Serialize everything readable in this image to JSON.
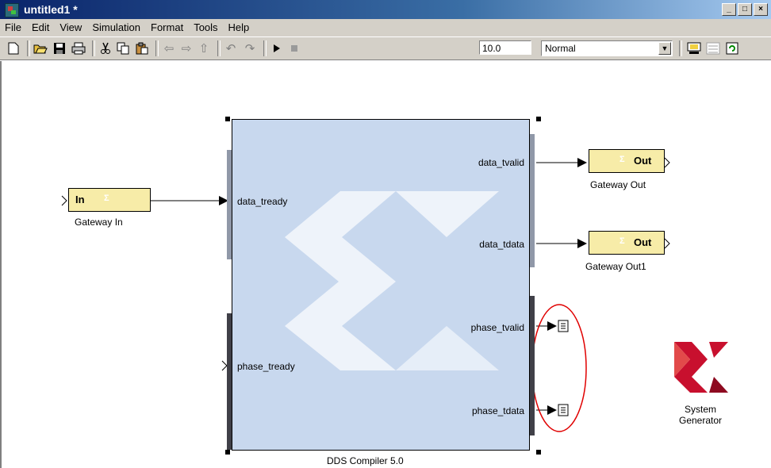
{
  "window": {
    "title": "untitled1 *",
    "buttons": [
      "_",
      "□",
      "×"
    ]
  },
  "menu": [
    "File",
    "Edit",
    "View",
    "Simulation",
    "Format",
    "Tools",
    "Help"
  ],
  "toolbar": {
    "stop_time": "10.0",
    "sim_mode": "Normal",
    "icons": [
      "new-icon",
      "open-icon",
      "save-icon",
      "print-icon",
      "cut-icon",
      "copy-icon",
      "paste-icon",
      "back-icon",
      "forward-icon",
      "up-icon",
      "undo-icon",
      "redo-icon",
      "play-icon",
      "stop-icon",
      "build-icon",
      "library-icon",
      "refresh-icon"
    ]
  },
  "model": {
    "gateway_in": {
      "text": "In",
      "label": "Gateway In"
    },
    "gateway_out": {
      "text": "Out",
      "label": "Gateway Out"
    },
    "gateway_out1": {
      "text": "Out",
      "label": "Gateway Out1"
    },
    "dds": {
      "label": "DDS Compiler 5.0",
      "inputs": [
        "data_tready",
        "phase_tready"
      ],
      "outputs": [
        "data_tvalid",
        "data_tdata",
        "phase_tvalid",
        "phase_tdata"
      ]
    },
    "system_generator": {
      "line1": "System",
      "line2": "Generator"
    }
  },
  "colors": {
    "gateway_fill": "#f7eca8",
    "dds_fill": "#c8d8ee",
    "highlight": "#e00000",
    "xilinx_red": "#c8102e"
  }
}
